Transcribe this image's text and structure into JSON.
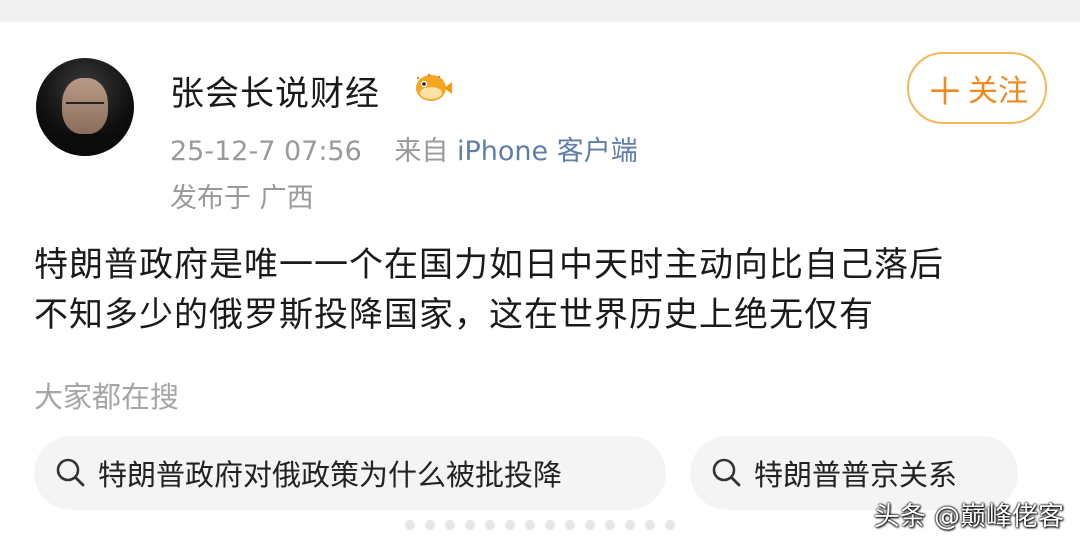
{
  "user": {
    "name": "张会长说财经",
    "avatar_icon": "user-avatar-photo",
    "badge_icon": "pufferfish-badge-icon"
  },
  "follow_button": {
    "plus": "＋",
    "label": "关注"
  },
  "meta": {
    "time": "25-12-7 07:56",
    "source_prefix": "来自",
    "client": "iPhone 客户端",
    "location": "发布于 广西"
  },
  "post": {
    "lines": [
      "特朗普政府是唯一一个在国力如日中天时主动向比自己落后",
      "不知多少的俄罗斯投降国家，这在世界历史上绝无仅有"
    ]
  },
  "search": {
    "title": "大家都在搜",
    "chips": [
      {
        "icon": "search-icon",
        "label": "特朗普政府对俄政策为什么被批投降"
      },
      {
        "icon": "search-icon",
        "label": "特朗普普京关系"
      }
    ]
  },
  "watermark": "头条 @巅峰佬客",
  "colors": {
    "follow_border": "#f2b85c",
    "follow_text": "#ee8a1e",
    "client_link": "#5f7ea8",
    "meta_text": "#9a9a9a",
    "chip_bg": "#f4f4f4"
  }
}
